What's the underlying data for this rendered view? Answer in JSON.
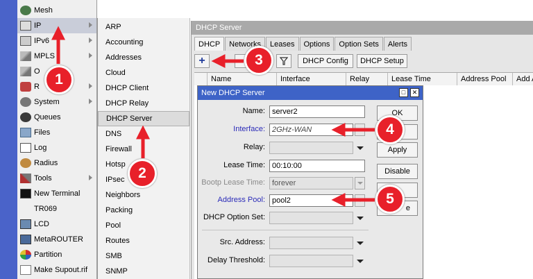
{
  "main_menu": {
    "items": [
      {
        "label": "Mesh",
        "icon": "mesh-icon"
      },
      {
        "label": "IP",
        "icon": "ip-icon",
        "submenu": true,
        "selected": true
      },
      {
        "label": "IPv6",
        "icon": "ipv6-icon",
        "submenu": true
      },
      {
        "label": "MPLS",
        "icon": "mpls-icon",
        "submenu": true
      },
      {
        "label": "O",
        "icon": "ospf-icon"
      },
      {
        "label": "R",
        "icon": "routing-icon",
        "submenu": true
      },
      {
        "label": "System",
        "icon": "gear-icon",
        "submenu": true
      },
      {
        "label": "Queues",
        "icon": "queues-icon"
      },
      {
        "label": "Files",
        "icon": "folder-icon"
      },
      {
        "label": "Log",
        "icon": "log-icon"
      },
      {
        "label": "Radius",
        "icon": "radius-icon"
      },
      {
        "label": "Tools",
        "icon": "tools-icon",
        "submenu": true
      },
      {
        "label": "New Terminal",
        "icon": "terminal-icon"
      },
      {
        "label": "TR069",
        "icon": ""
      },
      {
        "label": "LCD",
        "icon": "lcd-icon"
      },
      {
        "label": "MetaROUTER",
        "icon": "metarouter-icon"
      },
      {
        "label": "Partition",
        "icon": "partition-icon"
      },
      {
        "label": "Make Supout.rif",
        "icon": "supout-icon"
      }
    ]
  },
  "sub_menu": {
    "items": [
      "ARP",
      "Accounting",
      "Addresses",
      "Cloud",
      "DHCP Client",
      "DHCP Relay",
      "DHCP Server",
      "DNS",
      "Firewall",
      "Hotsp",
      "IPsec",
      "Neighbors",
      "Packing",
      "Pool",
      "Routes",
      "SMB",
      "SNMP"
    ],
    "selected_index": 6
  },
  "dhcp_window": {
    "title": "DHCP Server",
    "tabs": [
      "DHCP",
      "Networks",
      "Leases",
      "Options",
      "Option Sets",
      "Alerts"
    ],
    "active_tab": 0,
    "toolbar": {
      "add": "+",
      "dhcp_config": "DHCP Config",
      "dhcp_setup": "DHCP Setup",
      "filter": "filter-icon"
    },
    "columns": [
      "Name",
      "Interface",
      "Relay",
      "Lease Time",
      "Address Pool",
      "Add A"
    ]
  },
  "dialog": {
    "title": "New DHCP Server",
    "fields": {
      "name": {
        "label": "Name:",
        "value": "server2"
      },
      "interface": {
        "label": "Interface:",
        "value": "2GHz-WAN"
      },
      "relay": {
        "label": "Relay:",
        "value": ""
      },
      "lease_time": {
        "label": "Lease Time:",
        "value": "00:10:00"
      },
      "bootp_lease_time": {
        "label": "Bootp Lease Time:",
        "value": "forever"
      },
      "address_pool": {
        "label": "Address Pool:",
        "value": "pool2"
      },
      "dhcp_option_set": {
        "label": "DHCP Option Set:",
        "value": ""
      },
      "src_address": {
        "label": "Src. Address:",
        "value": ""
      },
      "delay_threshold": {
        "label": "Delay Threshold:",
        "value": ""
      }
    },
    "buttons": {
      "ok": "OK",
      "cancel": "",
      "apply": "Apply",
      "disable": "Disable",
      "copy": "",
      "remove": "e"
    }
  },
  "callouts": [
    "1",
    "2",
    "3",
    "4",
    "5"
  ],
  "colors": {
    "callout": "#e8202a",
    "sidebar": "#4a63c9",
    "dialog_title": "#3e63c7"
  }
}
